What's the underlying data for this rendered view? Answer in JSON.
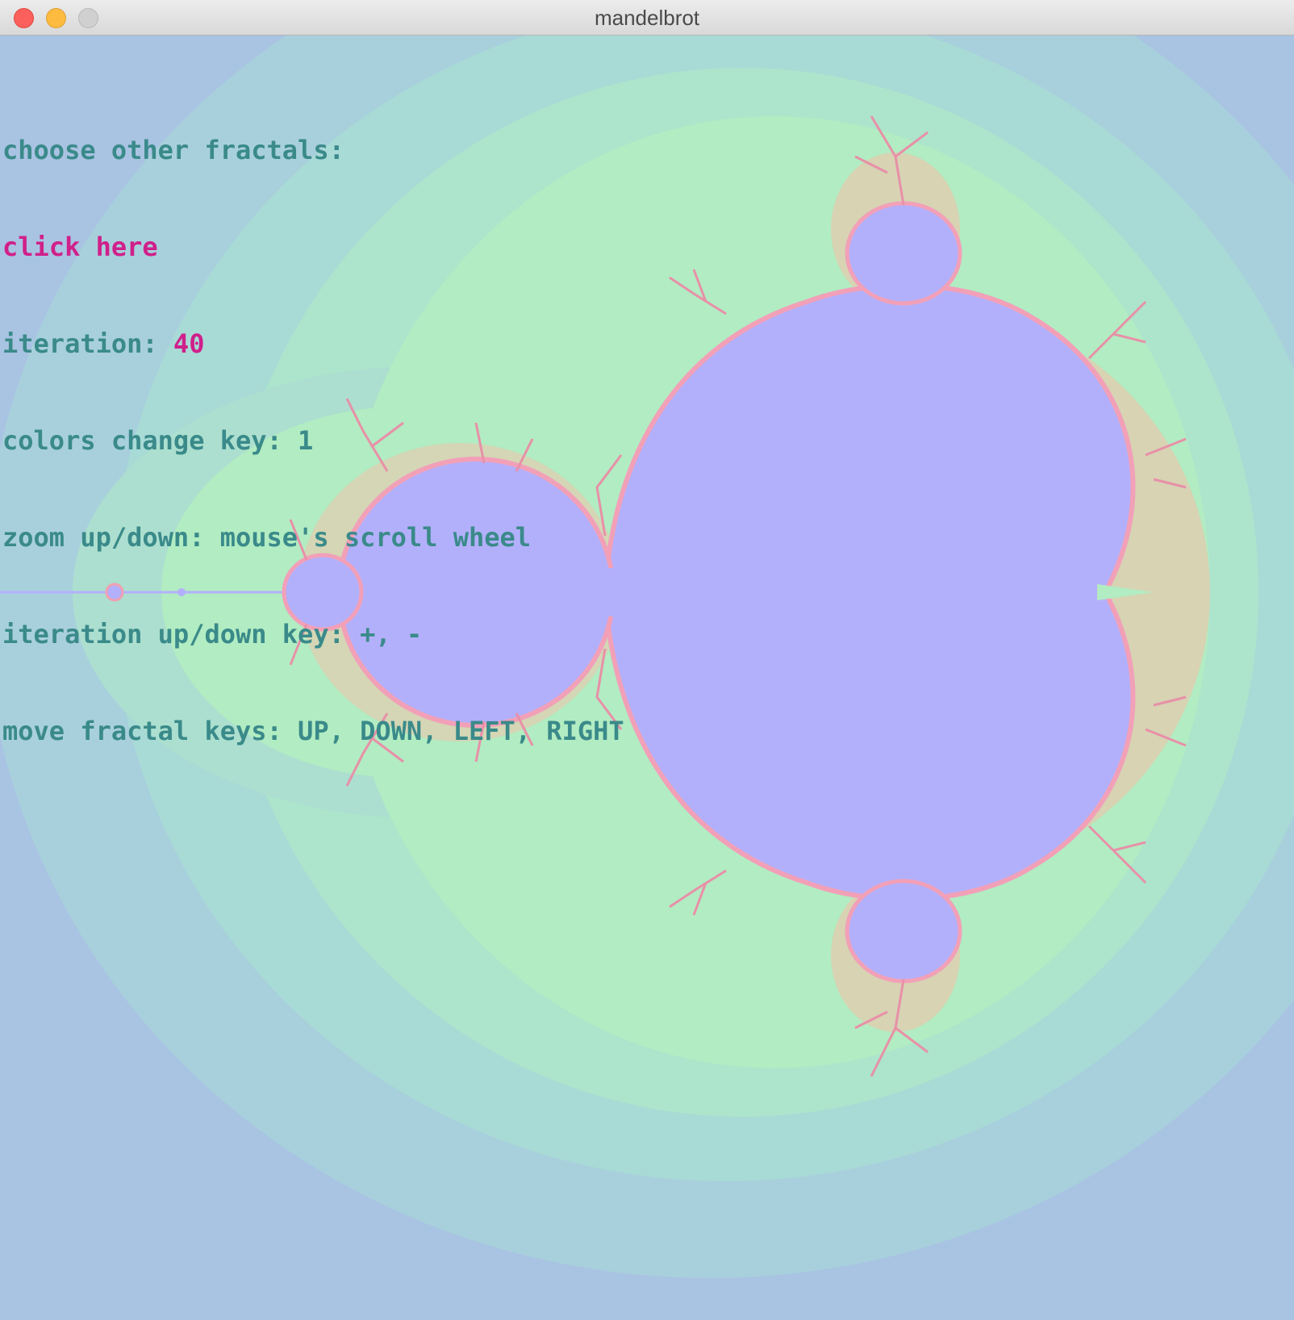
{
  "window": {
    "title": "mandelbrot"
  },
  "titlebar_controls": {
    "close": "close-button",
    "minimize": "minimize-button",
    "zoom": "zoom-button"
  },
  "info": {
    "choose_label": "choose other fractals:",
    "click_here": "click here",
    "iteration_label": "iteration: ",
    "iteration_value": "40",
    "colors_line": "colors change key: 1",
    "zoom_line": "zoom up/down: mouse's scroll wheel",
    "iteration_keys_line": "iteration up/down key: +, -",
    "move_line": "move fractal keys: UP, DOWN, LEFT, RIGHT"
  },
  "colors": {
    "background": "#a9c3e2",
    "set_interior": "#b3b0fb",
    "label_text": "#3a8a8a",
    "highlight_text": "#d0208a"
  },
  "fractal": {
    "type": "mandelbrot",
    "max_iteration": 40,
    "color_scheme": 1
  }
}
